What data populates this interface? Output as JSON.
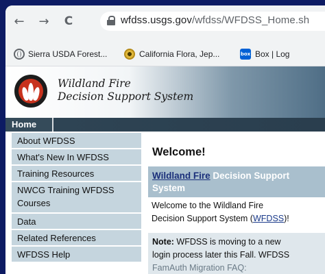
{
  "browser": {
    "url_domain": "wfdss.usgs.gov",
    "url_path": "/wfdss/WFDSS_Home.sh",
    "back_glyph": "←",
    "forward_glyph": "→",
    "reload_glyph": "C"
  },
  "bookmarks": [
    {
      "label": "Sierra USDA Forest...",
      "icon": "globe-icon"
    },
    {
      "label": "California Flora, Jep...",
      "icon": "flower-icon"
    },
    {
      "label": "Box | Log",
      "icon": "box-icon",
      "icon_text": "box"
    }
  ],
  "header": {
    "title_line1": "Wildland Fire",
    "title_line2": "Decision Support System"
  },
  "nav": {
    "home_label": "Home"
  },
  "sidebar": {
    "items": [
      "About WFDSS",
      "What's New In WFDSS",
      "Training Resources",
      "NWCG Training WFDSS",
      "Courses",
      "Data",
      "Related References",
      "WFDSS Help"
    ]
  },
  "main": {
    "welcome": "Welcome!",
    "dss_link": "Wildland Fire",
    "dss_rest_line1": " Decision Support",
    "dss_rest_line2": "System",
    "intro_line1": "Welcome to the Wildland Fire",
    "intro_line2_pre": "Decision Support System (",
    "intro_link": "WFDSS",
    "intro_line2_post": ")!",
    "note_label": "Note:",
    "note_line1": " WFDSS is moving to a new",
    "note_line2": "login process later this Fall. WFDSS",
    "note_line3": "FamAuth Migration FAQ:"
  },
  "colors": {
    "outer_background": "#0d1b63",
    "sidebar_item": "#c5d5de",
    "home_bar": "#2e4454",
    "logo_red": "#c8321d"
  }
}
